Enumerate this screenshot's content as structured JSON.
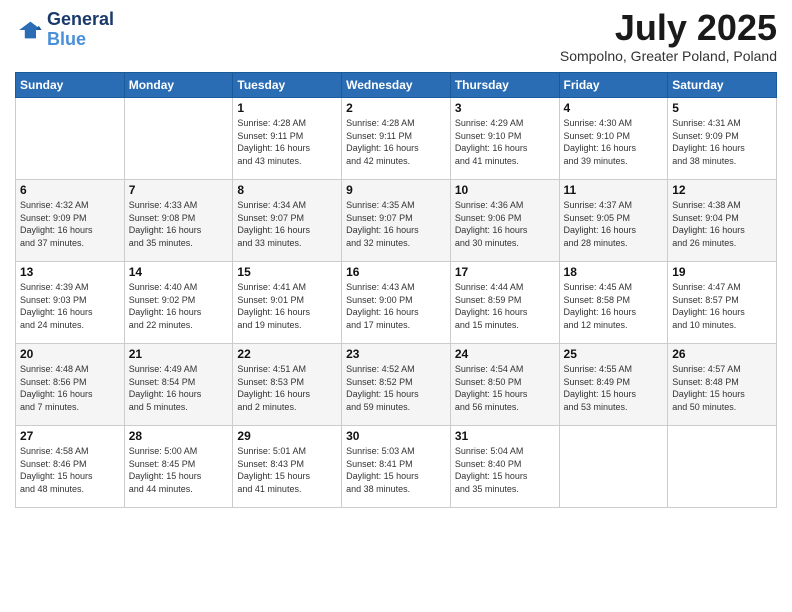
{
  "header": {
    "logo_line1": "General",
    "logo_line2": "Blue",
    "month": "July 2025",
    "location": "Sompolno, Greater Poland, Poland"
  },
  "weekdays": [
    "Sunday",
    "Monday",
    "Tuesday",
    "Wednesday",
    "Thursday",
    "Friday",
    "Saturday"
  ],
  "weeks": [
    [
      {
        "day": "",
        "info": ""
      },
      {
        "day": "",
        "info": ""
      },
      {
        "day": "1",
        "info": "Sunrise: 4:28 AM\nSunset: 9:11 PM\nDaylight: 16 hours\nand 43 minutes."
      },
      {
        "day": "2",
        "info": "Sunrise: 4:28 AM\nSunset: 9:11 PM\nDaylight: 16 hours\nand 42 minutes."
      },
      {
        "day": "3",
        "info": "Sunrise: 4:29 AM\nSunset: 9:10 PM\nDaylight: 16 hours\nand 41 minutes."
      },
      {
        "day": "4",
        "info": "Sunrise: 4:30 AM\nSunset: 9:10 PM\nDaylight: 16 hours\nand 39 minutes."
      },
      {
        "day": "5",
        "info": "Sunrise: 4:31 AM\nSunset: 9:09 PM\nDaylight: 16 hours\nand 38 minutes."
      }
    ],
    [
      {
        "day": "6",
        "info": "Sunrise: 4:32 AM\nSunset: 9:09 PM\nDaylight: 16 hours\nand 37 minutes."
      },
      {
        "day": "7",
        "info": "Sunrise: 4:33 AM\nSunset: 9:08 PM\nDaylight: 16 hours\nand 35 minutes."
      },
      {
        "day": "8",
        "info": "Sunrise: 4:34 AM\nSunset: 9:07 PM\nDaylight: 16 hours\nand 33 minutes."
      },
      {
        "day": "9",
        "info": "Sunrise: 4:35 AM\nSunset: 9:07 PM\nDaylight: 16 hours\nand 32 minutes."
      },
      {
        "day": "10",
        "info": "Sunrise: 4:36 AM\nSunset: 9:06 PM\nDaylight: 16 hours\nand 30 minutes."
      },
      {
        "day": "11",
        "info": "Sunrise: 4:37 AM\nSunset: 9:05 PM\nDaylight: 16 hours\nand 28 minutes."
      },
      {
        "day": "12",
        "info": "Sunrise: 4:38 AM\nSunset: 9:04 PM\nDaylight: 16 hours\nand 26 minutes."
      }
    ],
    [
      {
        "day": "13",
        "info": "Sunrise: 4:39 AM\nSunset: 9:03 PM\nDaylight: 16 hours\nand 24 minutes."
      },
      {
        "day": "14",
        "info": "Sunrise: 4:40 AM\nSunset: 9:02 PM\nDaylight: 16 hours\nand 22 minutes."
      },
      {
        "day": "15",
        "info": "Sunrise: 4:41 AM\nSunset: 9:01 PM\nDaylight: 16 hours\nand 19 minutes."
      },
      {
        "day": "16",
        "info": "Sunrise: 4:43 AM\nSunset: 9:00 PM\nDaylight: 16 hours\nand 17 minutes."
      },
      {
        "day": "17",
        "info": "Sunrise: 4:44 AM\nSunset: 8:59 PM\nDaylight: 16 hours\nand 15 minutes."
      },
      {
        "day": "18",
        "info": "Sunrise: 4:45 AM\nSunset: 8:58 PM\nDaylight: 16 hours\nand 12 minutes."
      },
      {
        "day": "19",
        "info": "Sunrise: 4:47 AM\nSunset: 8:57 PM\nDaylight: 16 hours\nand 10 minutes."
      }
    ],
    [
      {
        "day": "20",
        "info": "Sunrise: 4:48 AM\nSunset: 8:56 PM\nDaylight: 16 hours\nand 7 minutes."
      },
      {
        "day": "21",
        "info": "Sunrise: 4:49 AM\nSunset: 8:54 PM\nDaylight: 16 hours\nand 5 minutes."
      },
      {
        "day": "22",
        "info": "Sunrise: 4:51 AM\nSunset: 8:53 PM\nDaylight: 16 hours\nand 2 minutes."
      },
      {
        "day": "23",
        "info": "Sunrise: 4:52 AM\nSunset: 8:52 PM\nDaylight: 15 hours\nand 59 minutes."
      },
      {
        "day": "24",
        "info": "Sunrise: 4:54 AM\nSunset: 8:50 PM\nDaylight: 15 hours\nand 56 minutes."
      },
      {
        "day": "25",
        "info": "Sunrise: 4:55 AM\nSunset: 8:49 PM\nDaylight: 15 hours\nand 53 minutes."
      },
      {
        "day": "26",
        "info": "Sunrise: 4:57 AM\nSunset: 8:48 PM\nDaylight: 15 hours\nand 50 minutes."
      }
    ],
    [
      {
        "day": "27",
        "info": "Sunrise: 4:58 AM\nSunset: 8:46 PM\nDaylight: 15 hours\nand 48 minutes."
      },
      {
        "day": "28",
        "info": "Sunrise: 5:00 AM\nSunset: 8:45 PM\nDaylight: 15 hours\nand 44 minutes."
      },
      {
        "day": "29",
        "info": "Sunrise: 5:01 AM\nSunset: 8:43 PM\nDaylight: 15 hours\nand 41 minutes."
      },
      {
        "day": "30",
        "info": "Sunrise: 5:03 AM\nSunset: 8:41 PM\nDaylight: 15 hours\nand 38 minutes."
      },
      {
        "day": "31",
        "info": "Sunrise: 5:04 AM\nSunset: 8:40 PM\nDaylight: 15 hours\nand 35 minutes."
      },
      {
        "day": "",
        "info": ""
      },
      {
        "day": "",
        "info": ""
      }
    ]
  ]
}
